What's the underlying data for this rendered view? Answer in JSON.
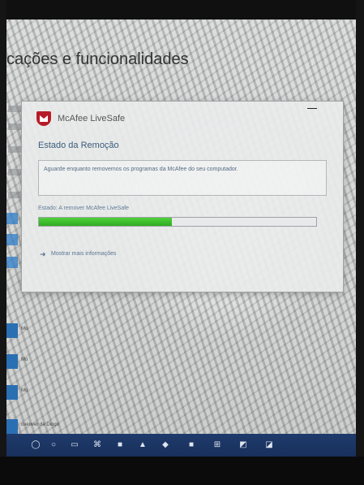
{
  "settings_page": {
    "title": "cações e funcionalidades"
  },
  "app_list": {
    "visible_labels": [
      "Mo",
      "Mo",
      "Mo",
      "Mo",
      "Mo",
      "Mo",
      "Mo",
      "Mo",
      "Mo"
    ]
  },
  "app_rows": [
    {
      "label": "Mo"
    },
    {
      "label": "Mo"
    },
    {
      "label": "Mo"
    },
    {
      "label": "ovenver de Diogo"
    }
  ],
  "dialog": {
    "app_name": "McAfee LiveSafe",
    "section_title": "Estado da Remoção",
    "description": "Aguarde enquanto removemos os programas da McAfee do seu computador.",
    "status_text": "Estado: A remover McAfee LiveSafe",
    "progress_fraction": 0.48,
    "more_link": "Mostrar mais informações"
  },
  "taskbar": {
    "icons": [
      "start-icon",
      "search-icon",
      "task-view-icon",
      "edge-icon",
      "explorer-icon",
      "store-icon",
      "mail-icon",
      "app-icon",
      "app-icon",
      "app-icon",
      "app-icon"
    ]
  }
}
